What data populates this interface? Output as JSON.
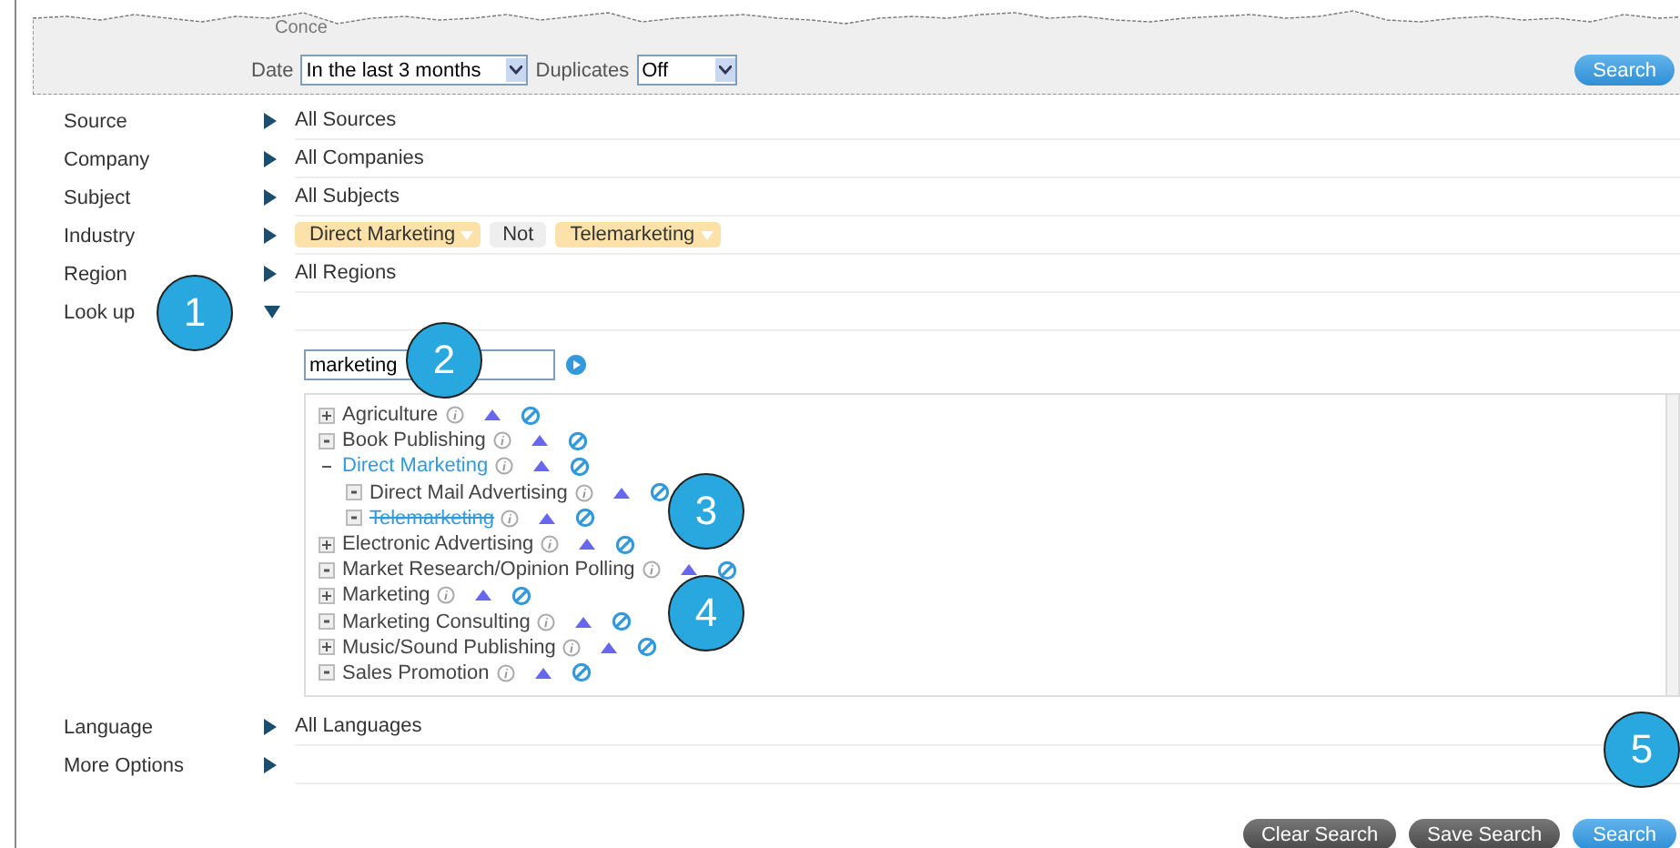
{
  "header": {
    "torn_label": "Conce",
    "date_label": "Date",
    "date_value": "In the last 3 months",
    "duplicates_label": "Duplicates",
    "duplicates_value": "Off",
    "search_button": "Search"
  },
  "filters": [
    {
      "label": "Source",
      "expanded": false,
      "value": "All Sources"
    },
    {
      "label": "Company",
      "expanded": false,
      "value": "All Companies"
    },
    {
      "label": "Subject",
      "expanded": false,
      "value": "All Subjects"
    },
    {
      "label": "Industry",
      "expanded": false,
      "tags": [
        {
          "text": "Direct Marketing",
          "kind": "tag"
        },
        {
          "text": "Not",
          "kind": "operator"
        },
        {
          "text": "Telemarketing",
          "kind": "tag"
        }
      ]
    },
    {
      "label": "Region",
      "expanded": false,
      "value": "All Regions"
    },
    {
      "label": "Look up",
      "expanded": true
    }
  ],
  "lookup": {
    "query": "marketing",
    "tree": [
      {
        "label": "Agriculture",
        "kind": "collapsed",
        "selected": false,
        "excluded": false
      },
      {
        "label": "Book Publishing",
        "kind": "leaf",
        "selected": false,
        "excluded": false
      },
      {
        "label": "Direct Marketing",
        "kind": "expanded",
        "selected": true,
        "excluded": false,
        "children": [
          {
            "label": "Direct Mail Advertising",
            "kind": "leaf",
            "selected": false,
            "excluded": false
          },
          {
            "label": "Telemarketing",
            "kind": "leaf",
            "selected": true,
            "excluded": true
          }
        ]
      },
      {
        "label": "Electronic Advertising",
        "kind": "collapsed",
        "selected": false,
        "excluded": false
      },
      {
        "label": "Market Research/Opinion Polling",
        "kind": "leaf",
        "selected": false,
        "excluded": false
      },
      {
        "label": "Marketing",
        "kind": "collapsed",
        "selected": false,
        "excluded": false
      },
      {
        "label": "Marketing Consulting",
        "kind": "leaf",
        "selected": false,
        "excluded": false
      },
      {
        "label": "Music/Sound Publishing",
        "kind": "collapsed",
        "selected": false,
        "excluded": false
      },
      {
        "label": "Sales Promotion",
        "kind": "leaf",
        "selected": false,
        "excluded": false
      }
    ]
  },
  "more_filters": [
    {
      "label": "Language",
      "expanded": false,
      "value": "All Languages"
    },
    {
      "label": "More Options",
      "expanded": false
    }
  ],
  "buttons": [
    {
      "label": "Clear Search",
      "kind": "secondary"
    },
    {
      "label": "Save Search",
      "kind": "secondary"
    },
    {
      "label": "Search",
      "kind": "primary"
    }
  ],
  "callouts": [
    "1",
    "2",
    "3",
    "4",
    "5"
  ]
}
